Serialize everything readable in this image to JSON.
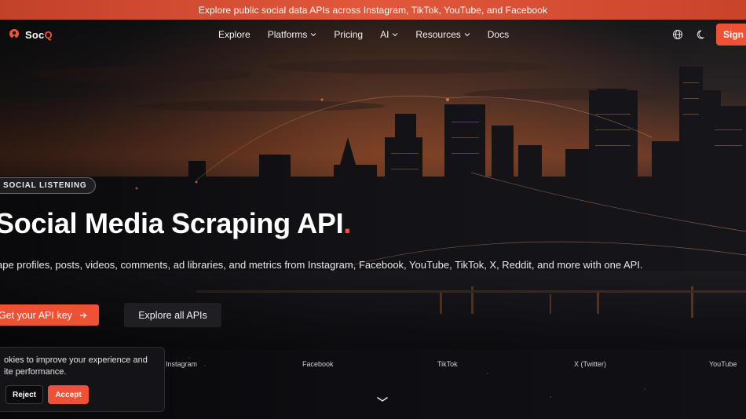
{
  "banner": {
    "text": "Explore public social data APIs across Instagram, TikTok, YouTube, and Facebook"
  },
  "brand": {
    "name_part1": "Soc",
    "name_part2": "Q",
    "accent": "#ef5135"
  },
  "nav": {
    "items": [
      {
        "label": "Explore",
        "has_dropdown": false
      },
      {
        "label": "Platforms",
        "has_dropdown": true
      },
      {
        "label": "Pricing",
        "has_dropdown": false
      },
      {
        "label": "AI",
        "has_dropdown": true
      },
      {
        "label": "Resources",
        "has_dropdown": true
      },
      {
        "label": "Docs",
        "has_dropdown": false
      }
    ],
    "signin_label": "Sign i",
    "icons": [
      "globe-icon",
      "moon-icon"
    ]
  },
  "hero": {
    "badge": "SOCIAL LISTENING",
    "headline": "Social Media Scraping API",
    "headline_dot": ".",
    "subline": "ape profiles, posts, videos, comments, ad libraries, and metrics from Instagram, Facebook, YouTube, TikTok, X, Reddit, and more with one API.",
    "cta_primary": "Get your API key",
    "cta_secondary": "Explore all APIs"
  },
  "platforms": [
    "Instagram",
    "Facebook",
    "TikTok",
    "X (Twitter)",
    "YouTube"
  ],
  "cookie": {
    "text": "okies to improve your experience and ite performance.",
    "line1": "okies to improve your experience and",
    "line2": "ite performance.",
    "reject_label": "Reject",
    "accept_label": "Accept"
  }
}
